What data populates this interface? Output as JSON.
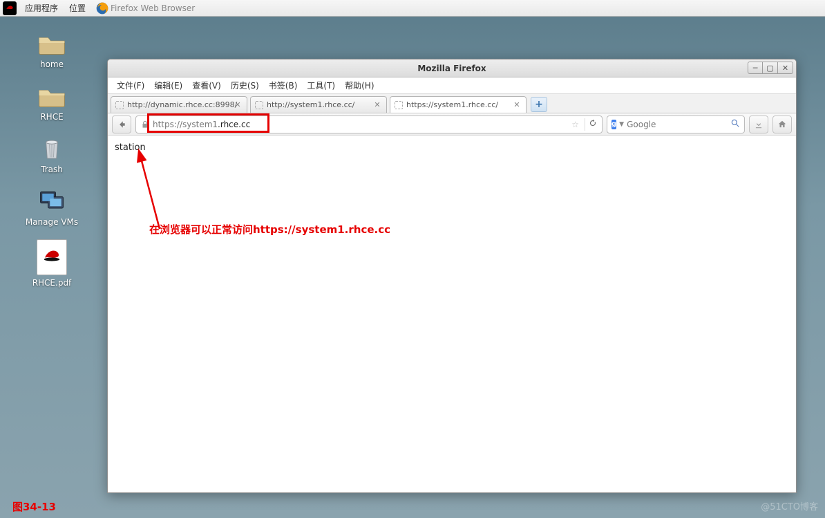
{
  "panel": {
    "apps": "应用程序",
    "places": "位置",
    "taskTitle": "Firefox Web Browser"
  },
  "desktop": {
    "home": "home",
    "rhce": "RHCE",
    "trash": "Trash",
    "vms": "Manage VMs",
    "pdf": "RHCE.pdf"
  },
  "window": {
    "title": "Mozilla Firefox",
    "menu": {
      "file": "文件(F)",
      "edit": "编辑(E)",
      "view": "查看(V)",
      "history": "历史(S)",
      "bookmarks": "书签(B)",
      "tools": "工具(T)",
      "help": "帮助(H)"
    },
    "tabs": [
      {
        "label": "http://dynamic.rhce.cc:8998/",
        "active": false
      },
      {
        "label": "http://system1.rhce.cc/",
        "active": false
      },
      {
        "label": "https://system1.rhce.cc/",
        "active": true
      }
    ],
    "newtab": "+",
    "url_grey": "https://system1",
    "url_dark": ".rhce.cc",
    "search": {
      "engine": "g",
      "placeholder": "Google"
    },
    "page_body": "station"
  },
  "annotation": {
    "text": "在浏览器可以正常访问https://system1.rhce.cc"
  },
  "figlabel": "图34-13",
  "watermark": "@51CTO博客"
}
